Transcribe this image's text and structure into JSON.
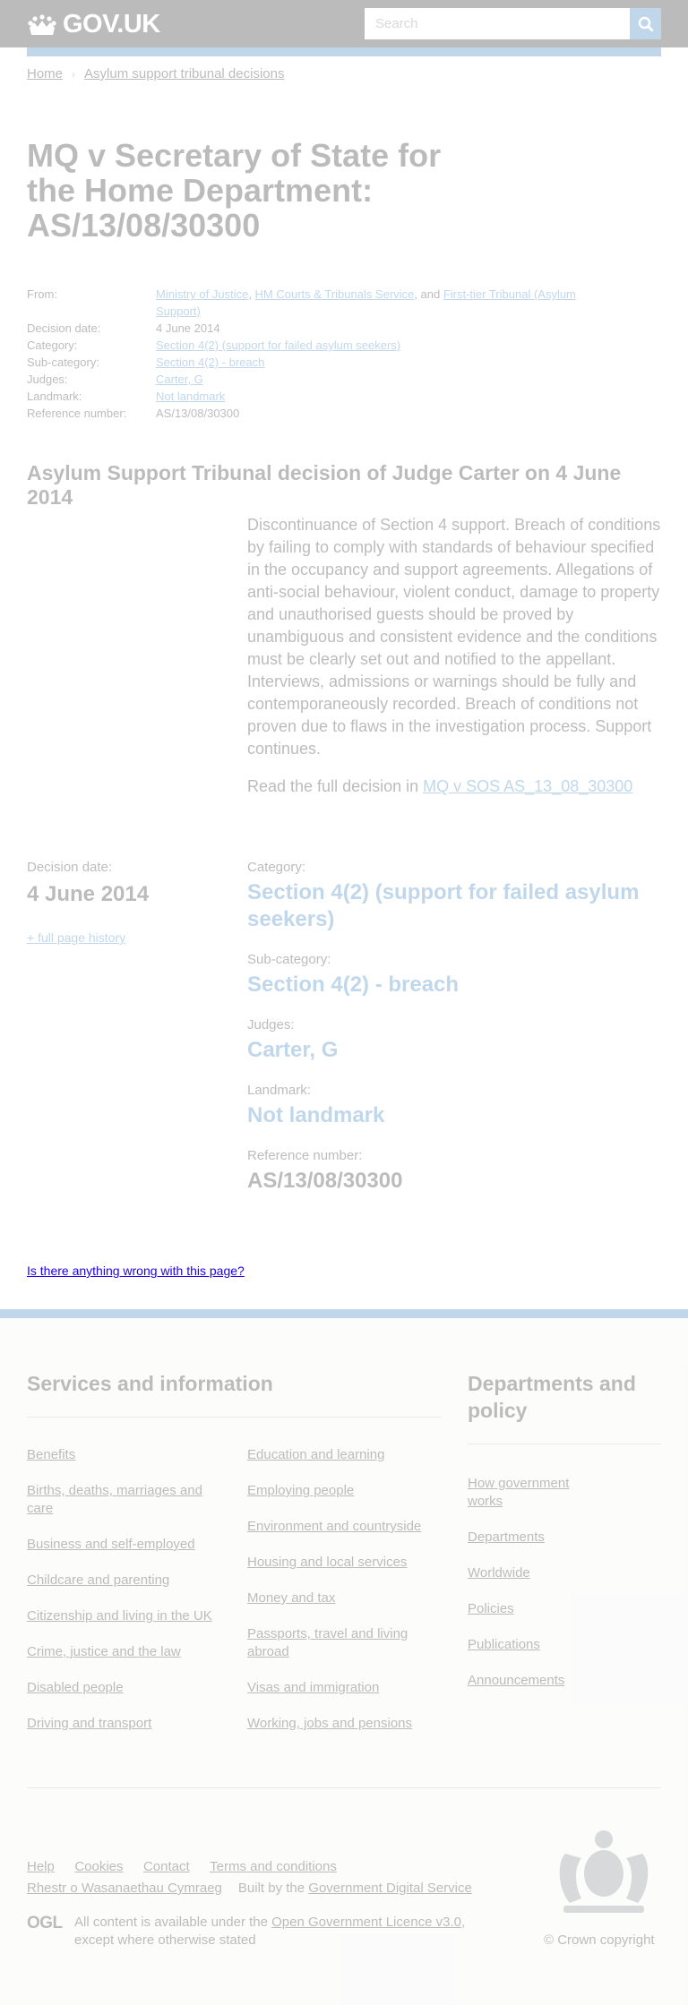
{
  "header": {
    "logo_text": "GOV.UK",
    "search_placeholder": "Search"
  },
  "breadcrumbs": [
    {
      "label": "Home"
    },
    {
      "label": "Asylum support tribunal decisions"
    }
  ],
  "title": "MQ v Secretary of State for the Home Department: AS/13/08/30300",
  "metadata": {
    "from_label": "From:",
    "from_links": [
      "Ministry of Justice",
      "HM Courts & Tribunals Service",
      "First-tier Tribunal (Asylum Support)"
    ],
    "from_sep1": ", ",
    "from_sep2": ", and ",
    "decision_date_label": "Decision date:",
    "decision_date": "4 June 2014",
    "category_label": "Category:",
    "category": "Section 4(2) (support for failed asylum seekers)",
    "subcategory_label": "Sub-category:",
    "subcategory": "Section 4(2) - breach",
    "judges_label": "Judges:",
    "judges": "Carter, G",
    "landmark_label": "Landmark:",
    "landmark": "Not landmark",
    "reference_label": "Reference number:",
    "reference": "AS/13/08/30300"
  },
  "decision": {
    "subtitle": "Asylum Support Tribunal decision of Judge Carter on 4 June 2014",
    "summary": "Discontinuance of Section 4 support. Breach of conditions by failing to comply with standards of behaviour specified in the occupancy and support agreements. Allegations of anti-social behaviour, violent conduct, damage to property and unauthorised guests should be proved by unambiguous and consistent evidence and the conditions must be clearly set out and notified to the appellant. Interviews, admissions or warnings should be fully and contemporaneously recorded. Breach of conditions not proven due to flaws in the investigation process. Support continues.",
    "read_full_prefix": "Read the full decision in ",
    "read_full_link": "MQ v SOS AS_13_08_30300"
  },
  "details": {
    "decision_date_label": "Decision date:",
    "decision_date": "4 June 2014",
    "history_link": "+ full page history",
    "category_label": "Category:",
    "category": "Section 4(2) (support for failed asylum seekers)",
    "subcategory_label": "Sub-category:",
    "subcategory": "Section 4(2) - breach",
    "judges_label": "Judges:",
    "judges": "Carter, G",
    "landmark_label": "Landmark:",
    "landmark": "Not landmark",
    "reference_label": "Reference number:",
    "reference": "AS/13/08/30300"
  },
  "feedback": {
    "link": "Is there anything wrong with this page?"
  },
  "footer": {
    "services_heading": "Services and information",
    "services_col1": [
      "Benefits",
      "Births, deaths, marriages and care",
      "Business and self-employed",
      "Childcare and parenting",
      "Citizenship and living in the UK",
      "Crime, justice and the law",
      "Disabled people",
      "Driving and transport"
    ],
    "services_col2": [
      "Education and learning",
      "Employing people",
      "Environment and countryside",
      "Housing and local services",
      "Money and tax",
      "Passports, travel and living abroad",
      "Visas and immigration",
      "Working, jobs and pensions"
    ],
    "departments_heading": "Departments and policy",
    "departments": [
      "How government works",
      "Departments",
      "Worldwide",
      "Policies",
      "Publications",
      "Announcements"
    ],
    "bottom_links": [
      "Help",
      "Cookies",
      "Contact",
      "Terms and conditions"
    ],
    "welsh_link": "Rhestr o Wasanaethau Cymraeg",
    "built_by_prefix": "Built by the ",
    "built_by_link": "Government Digital Service",
    "ogl_logo": "OGL",
    "licence_prefix": "All content is available under the ",
    "licence_link": "Open Government Licence v3.0",
    "licence_suffix": ", except where otherwise stated",
    "copyright": "© Crown copyright"
  }
}
